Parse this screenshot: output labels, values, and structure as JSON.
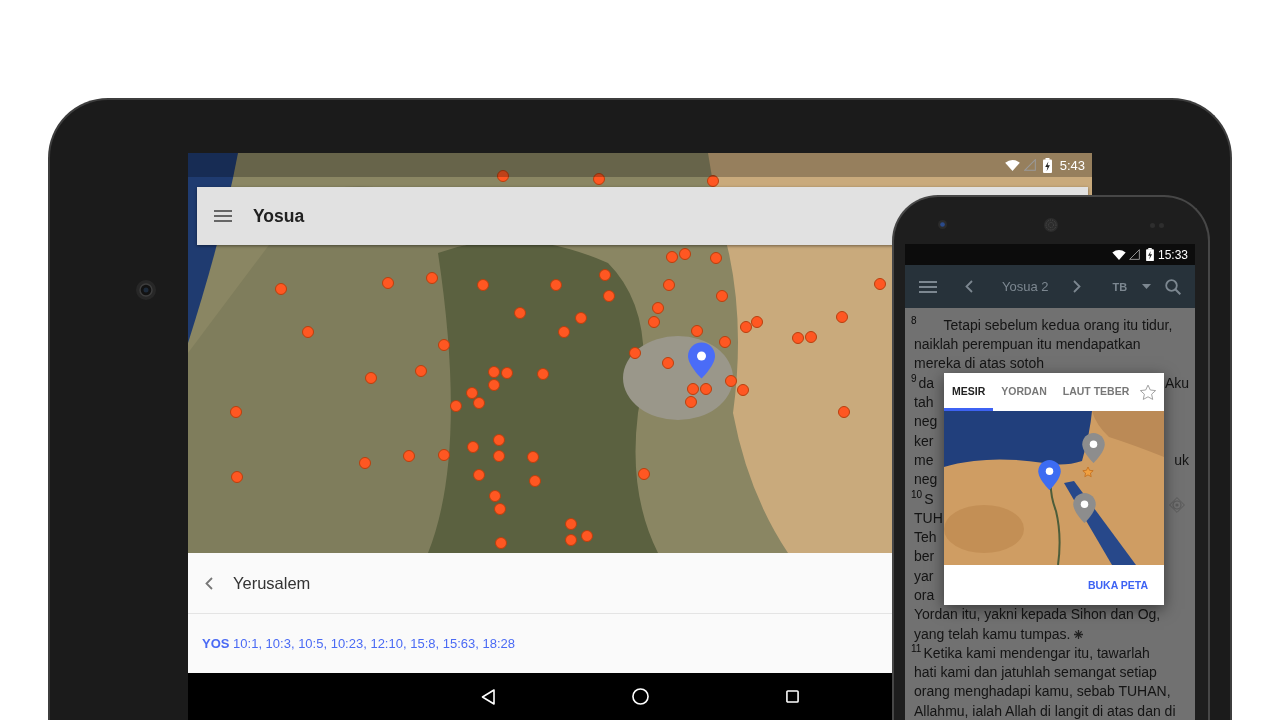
{
  "tablet": {
    "status_bar": {
      "time": "5:43"
    },
    "app_bar": {
      "title": "Yosua"
    },
    "place_sheet": {
      "title": "Yerusalem",
      "references": "**YOS** 10:1, 10:3, 10:5, 10:23, 12:10, 15:8, 15:63, 18:28"
    }
  },
  "phone": {
    "status_bar": {
      "time": "15:33"
    },
    "toolbar": {
      "title": "Yosua 2",
      "version": "TB"
    },
    "reader": {
      "lines": [
        {
          "kind": "paragraph",
          "verse": "8",
          "text": "Tetapi sebelum kedua orang itu tidur,"
        },
        {
          "kind": "line",
          "text": "naiklah perempuan itu mendapatkan"
        },
        {
          "kind": "line",
          "text": "mereka di atas sotoh"
        },
        {
          "kind": "verse",
          "verse": "9",
          "text": "da",
          "right": "Aku"
        },
        {
          "kind": "line",
          "text": "tah"
        },
        {
          "kind": "line",
          "text": "neg"
        },
        {
          "kind": "line",
          "text": "ker"
        },
        {
          "kind": "line",
          "text": "me",
          "right": "uk"
        },
        {
          "kind": "line",
          "text": "neg"
        },
        {
          "kind": "verse",
          "verse": "10",
          "text": "S"
        },
        {
          "kind": "line",
          "text": "TUH"
        },
        {
          "kind": "line",
          "text": "Teh"
        },
        {
          "kind": "line",
          "text": "ber"
        },
        {
          "kind": "line",
          "text": "yar"
        },
        {
          "kind": "line",
          "text": "ora"
        },
        {
          "kind": "line",
          "text": "Yordan itu, yakni kepada Sihon dan Og,"
        },
        {
          "kind": "line",
          "text": "yang telah kamu tumpas.",
          "note_mark": true
        },
        {
          "kind": "verse",
          "verse": "11",
          "text": "Ketika kami mendengar itu, tawarlah"
        },
        {
          "kind": "line",
          "text": "hati kami dan jatuhlah semangat setiap"
        },
        {
          "kind": "line",
          "text": "orang menghadapi kamu, sebab TUHAN,"
        },
        {
          "kind": "line",
          "text": "Allahmu, ialah Allah di langit di atas dan di"
        }
      ]
    },
    "map_dialog": {
      "tabs": [
        {
          "label": "MESIR",
          "selected": true
        },
        {
          "label": "YORDAN",
          "selected": false
        },
        {
          "label": "LAUT TEBER",
          "selected": false
        }
      ],
      "starred": false,
      "action": "BUKA PETA"
    }
  }
}
